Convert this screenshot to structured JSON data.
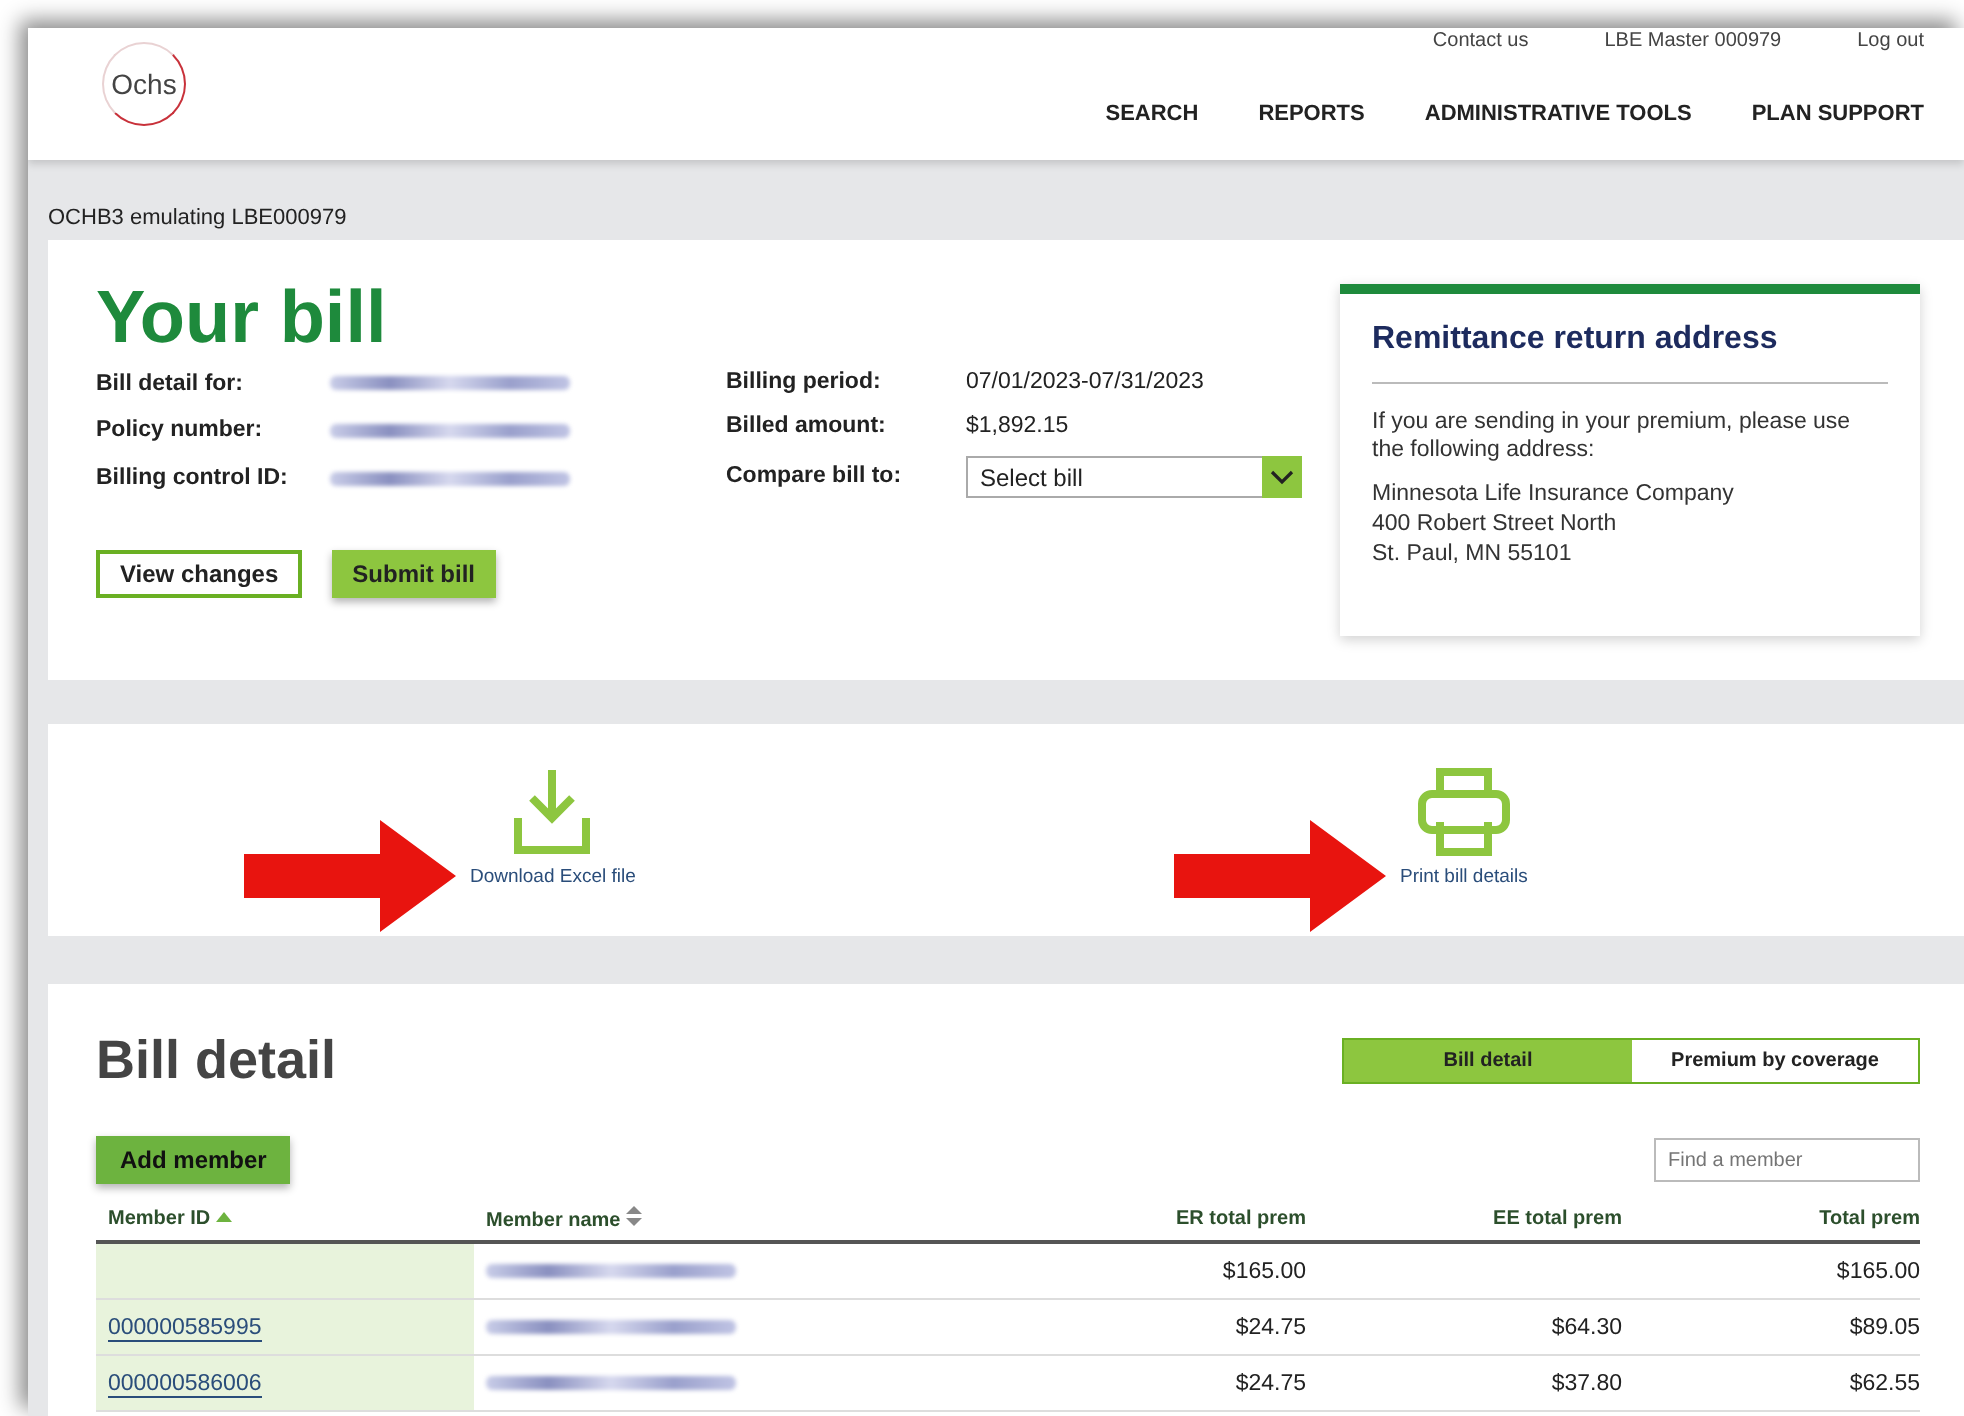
{
  "header": {
    "logo": "Ochs",
    "top_links": [
      "Contact us",
      "LBE Master 000979",
      "Log out"
    ],
    "nav": [
      "SEARCH",
      "REPORTS",
      "ADMINISTRATIVE TOOLS",
      "PLAN SUPPORT"
    ]
  },
  "emulation_note": "OCHB3 emulating LBE000979",
  "bill": {
    "title": "Your bill",
    "left_fields": [
      {
        "label": "Bill detail for:",
        "redacted": true
      },
      {
        "label": "Policy number:",
        "redacted": true
      },
      {
        "label": "Billing control ID:",
        "redacted": true
      }
    ],
    "right_fields": [
      {
        "label": "Billing period:",
        "value": "07/01/2023-07/31/2023"
      },
      {
        "label": "Billed amount:",
        "value": "$1,892.15"
      }
    ],
    "compare": {
      "label": "Compare bill to:",
      "placeholder": "Select bill"
    },
    "buttons": [
      {
        "label": "View changes",
        "kind": "outline"
      },
      {
        "label": "Submit bill",
        "kind": "primary"
      }
    ]
  },
  "remittance": {
    "title": "Remittance return address",
    "note": "If you are sending in your premium, please use the following address:",
    "address": [
      "Minnesota Life Insurance Company",
      "400 Robert Street North",
      "St. Paul, MN 55101"
    ]
  },
  "actions": [
    {
      "label": "Download Excel file",
      "kind": "download"
    },
    {
      "label": "Print bill details",
      "kind": "print"
    }
  ],
  "detail": {
    "title": "Bill detail",
    "view_tabs": [
      {
        "label": "Bill detail",
        "selected": true
      },
      {
        "label": "Premium by coverage",
        "selected": false
      }
    ],
    "add_button": "Add member",
    "search": {
      "placeholder": "Find a member"
    },
    "columns": [
      {
        "label": "Member ID",
        "sorted": true
      },
      {
        "label": "Member name",
        "sorted": false
      },
      {
        "label": "ER total prem"
      },
      {
        "label": "EE total prem"
      },
      {
        "label": "Total prem"
      }
    ],
    "rows": [
      {
        "name_redacted": true,
        "er_total": "$165.00",
        "total": "$165.00"
      },
      {
        "member_id": "000000585995",
        "name_redacted": true,
        "er_total": "$24.75",
        "ee_total": "$64.30",
        "total": "$89.05"
      },
      {
        "member_id": "000000586006",
        "name_redacted": true,
        "er_total": "$24.75",
        "ee_total": "$37.80",
        "total": "$62.55"
      }
    ]
  }
}
